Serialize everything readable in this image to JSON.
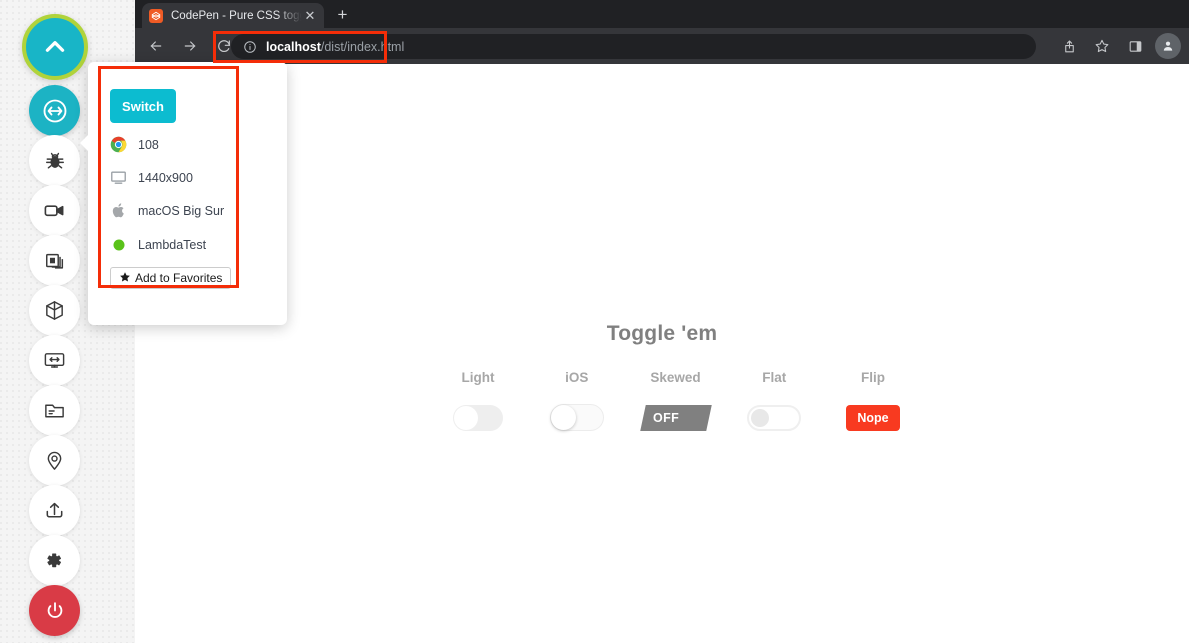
{
  "sidebar": {
    "logo": {
      "name": "lambdatest-logo",
      "icon": "chevron-up-icon",
      "ring_color": "#b0d33b",
      "fill_color": "#18b5c7"
    },
    "items": [
      {
        "name": "switch-browser",
        "icon": "sync-switch-icon",
        "active": true
      },
      {
        "name": "bug-report",
        "icon": "bug-icon",
        "active": false
      },
      {
        "name": "record-video",
        "icon": "video-camera-icon",
        "active": false
      },
      {
        "name": "screenshot",
        "icon": "screenshot-stack-icon",
        "active": false
      },
      {
        "name": "cube",
        "icon": "cube-icon",
        "active": false
      },
      {
        "name": "responsive",
        "icon": "monitor-resize-icon",
        "active": false
      },
      {
        "name": "files",
        "icon": "folder-icon",
        "active": false
      },
      {
        "name": "geolocation",
        "icon": "location-pin-icon",
        "active": false
      },
      {
        "name": "upload",
        "icon": "upload-icon",
        "active": false
      },
      {
        "name": "settings",
        "icon": "gear-icon",
        "active": false
      },
      {
        "name": "power-off",
        "icon": "power-icon",
        "active": false,
        "color": "#d93b46"
      }
    ]
  },
  "browser": {
    "tab": {
      "title": "CodePen - Pure CSS toggle bu",
      "favicon": "codepen-favicon",
      "close_label": "✕"
    },
    "new_tab_label": "+",
    "nav": {
      "back_label": "←",
      "forward_label": "→",
      "reload_label": "↻"
    },
    "omnibox": {
      "info_icon": "info-circle-icon",
      "host": "localhost",
      "path": "/dist/index.html"
    },
    "toolbar_right": [
      {
        "name": "share-icon"
      },
      {
        "name": "bookmark-star-icon"
      },
      {
        "name": "side-panel-icon"
      },
      {
        "name": "profile-avatar"
      }
    ]
  },
  "popup": {
    "switch_label": "Switch",
    "rows": [
      {
        "icon": "chrome-icon",
        "label": "108"
      },
      {
        "icon": "monitor-icon",
        "label": "1440x900"
      },
      {
        "icon": "apple-icon",
        "label": "macOS Big Sur"
      },
      {
        "icon": "status-dot-icon",
        "label": "LambdaTest"
      }
    ],
    "favorites_label": "Add to Favorites",
    "favorites_icon": "star-icon",
    "accent_color": "#0cbcd0"
  },
  "page": {
    "title": "Toggle 'em",
    "toggles": [
      {
        "label": "Light",
        "style": "light",
        "state": "off",
        "state_text": ""
      },
      {
        "label": "iOS",
        "style": "ios",
        "state": "off",
        "state_text": ""
      },
      {
        "label": "Skewed",
        "style": "skewed",
        "state": "off",
        "state_text": "OFF"
      },
      {
        "label": "Flat",
        "style": "flat",
        "state": "off",
        "state_text": ""
      },
      {
        "label": "Flip",
        "style": "flip",
        "state": "off",
        "state_text": "Nope"
      }
    ]
  },
  "highlights": [
    {
      "name": "url-highlight",
      "color": "#f42d08"
    },
    {
      "name": "popup-highlight",
      "color": "#f42d08"
    }
  ]
}
